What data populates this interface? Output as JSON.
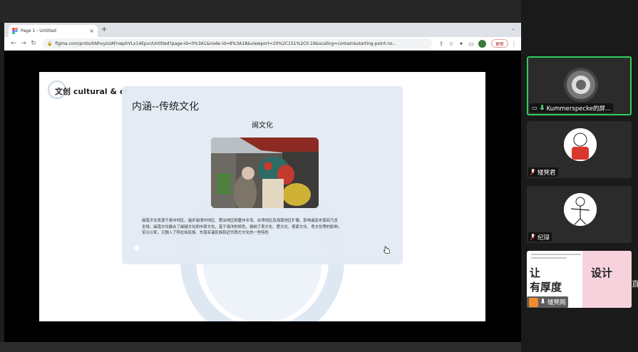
{
  "browser": {
    "tab_title": "Page 1 - Untitled",
    "tab_close": "×",
    "new_tab": "+",
    "tab_menu": "⌄",
    "nav_back": "←",
    "nav_forward": "→",
    "nav_reload": "↻",
    "url": "figma.com/proto/kNhvyUzAFnwphVLx14Epvr/Untitled?page-id=0%3A1&node-id=8%3A18&viewport=20%2C151%2C0.19&scaling=contain&starting-point-no...",
    "update_label": "更新",
    "kebab": "⋮"
  },
  "slide": {
    "heading": "文创 cultural & cr",
    "card_title": "内涵--传统文化",
    "card_subtitle": "闽文化",
    "body_lines": [
      "闽南文化发源于泉州地区，遍步闽漳州地区、惠汕地区和雷州半岛、台湾地区及海南地区扩展，影响遍及东南亚乃至",
      "全球。闽南文化融合了闽越文化和中原文化，富于海洋的特色，接纳了吴文化、楚文化、客家文化、粤文化等的影响，",
      "宋元以来，又融入了阿拉伯民族、东南亚诸民族和近代西方文化的一些特色"
    ]
  },
  "participants": [
    {
      "name": "Kummerspecke的屏...",
      "active": true
    },
    {
      "name": "矮凳君",
      "active": false
    },
    {
      "name": "纪琭",
      "active": false
    },
    {
      "name": "矮凳网",
      "active": false
    }
  ],
  "thumb": {
    "line1": "让",
    "line1b": "设计",
    "line2": "有厚度"
  },
  "side_glyph": "直",
  "colors": {
    "active_border": "#2fcf5e",
    "update_red": "#b3261e",
    "thumb_pink": "#f7d2dc"
  }
}
